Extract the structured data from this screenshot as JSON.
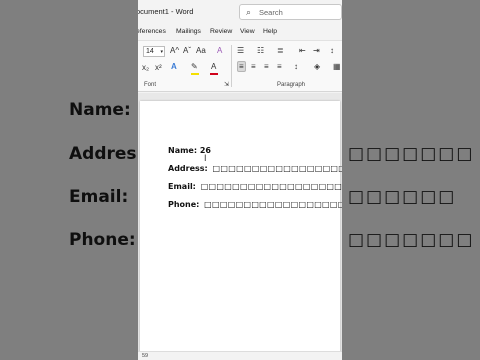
{
  "background": {
    "lines": [
      {
        "label": "Name:",
        "suffix": ""
      },
      {
        "label": "Addres",
        "suffix": "□□□□□□□"
      },
      {
        "label": "Email:",
        "suffix": "□□□□□□"
      },
      {
        "label": "Phone:",
        "suffix": "□□□□□□□"
      }
    ]
  },
  "window": {
    "title": "ocument1 - Word",
    "search_placeholder": "Search"
  },
  "menu": {
    "items": [
      "eferences",
      "Mailings",
      "Review",
      "View",
      "Help"
    ]
  },
  "ribbon": {
    "font_size": "14",
    "grow_font": "A^",
    "shrink_font": "Aˇ",
    "change_case": "Aa",
    "clear_format": "A",
    "subscript": "x₂",
    "superscript": "x²",
    "text_effects": "A",
    "highlight": "✎",
    "font_color": "A",
    "font_group_label": "Font",
    "paragraph_group_label": "Paragraph",
    "highlight_color": "#f5e000",
    "font_color_value": "#d0021b",
    "accent_text_effect": "#3a7bd5"
  },
  "document": {
    "fields": [
      {
        "label": "Name:",
        "value": "26",
        "boxes": ""
      },
      {
        "label": "Address:",
        "value": "",
        "boxes": "□□□□□□□□□□□□□□□□□□"
      },
      {
        "label": "Email:",
        "value": "",
        "boxes": "□□□□□□□□□□□□□□□□□□"
      },
      {
        "label": "Phone:",
        "value": "",
        "boxes": "□□□□□□□□□□□□□□□□□□"
      }
    ]
  },
  "status": {
    "page_info": "59"
  }
}
